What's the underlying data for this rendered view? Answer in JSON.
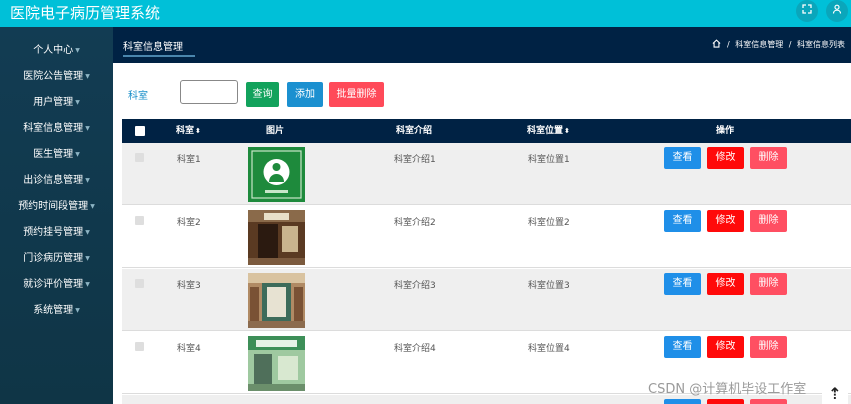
{
  "app": {
    "title": "医院电子病历管理系统"
  },
  "sidebar": {
    "items": [
      {
        "label": "个人中心"
      },
      {
        "label": "医院公告管理"
      },
      {
        "label": "用户管理"
      },
      {
        "label": "科室信息管理"
      },
      {
        "label": "医生管理"
      },
      {
        "label": "出诊信息管理"
      },
      {
        "label": "预约时间段管理"
      },
      {
        "label": "预约挂号管理"
      },
      {
        "label": "门诊病历管理"
      },
      {
        "label": "就诊评价管理"
      },
      {
        "label": "系统管理"
      }
    ]
  },
  "header": {
    "tab": "科室信息管理",
    "breadcrumb": [
      "科室信息管理",
      "科室信息列表"
    ],
    "breadcrumb_sep": "/"
  },
  "search": {
    "label": "科室",
    "value": "",
    "query_label": "查询",
    "add_label": "添加",
    "batch_delete_label": "批量删除"
  },
  "table": {
    "columns": {
      "dept": "科室",
      "image": "图片",
      "intro": "科室介绍",
      "location": "科室位置",
      "actions": "操作"
    },
    "sort_glyph": "⬍",
    "action_labels": {
      "view": "查看",
      "edit": "修改",
      "delete": "删除"
    },
    "rows": [
      {
        "dept": "科室1",
        "intro": "科室介绍1",
        "location": "科室位置1"
      },
      {
        "dept": "科室2",
        "intro": "科室介绍2",
        "location": "科室位置2"
      },
      {
        "dept": "科室3",
        "intro": "科室介绍3",
        "location": "科室位置3"
      },
      {
        "dept": "科室4",
        "intro": "科室介绍4",
        "location": "科室位置4"
      }
    ]
  },
  "watermark": "CSDN @计算机毕设工作室",
  "colors": {
    "topbar": "#00c0d8",
    "sidebar": "#123c53",
    "header": "#002244",
    "accent": "#1b90d0"
  }
}
